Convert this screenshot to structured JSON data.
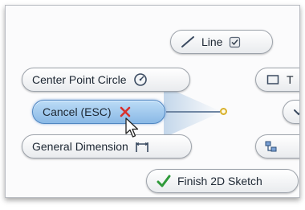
{
  "marking_menu": {
    "items": {
      "line": {
        "label": "Line",
        "icon": "line-icon"
      },
      "center_point_circle": {
        "label": "Center Point Circle",
        "icon": "circle-icon"
      },
      "cancel": {
        "label": "Cancel (ESC)",
        "icon": "close-icon"
      },
      "general_dimension": {
        "label": "General Dimension",
        "icon": "dimension-icon"
      },
      "finish_2d_sketch": {
        "label": "Finish 2D Sketch",
        "icon": "checkmark-icon"
      },
      "partial_top_right": {
        "label": "T",
        "icon": "rectangle-icon"
      },
      "partial_right": {
        "label": "",
        "icon": "chevron-icon"
      },
      "partial_bottom_right": {
        "label": "",
        "icon": "pattern-icon"
      }
    },
    "active_item": "cancel"
  },
  "colors": {
    "accent": "#8ab9e6",
    "cancel_x": "#d9302c",
    "finish_check": "#2f9a3a"
  }
}
